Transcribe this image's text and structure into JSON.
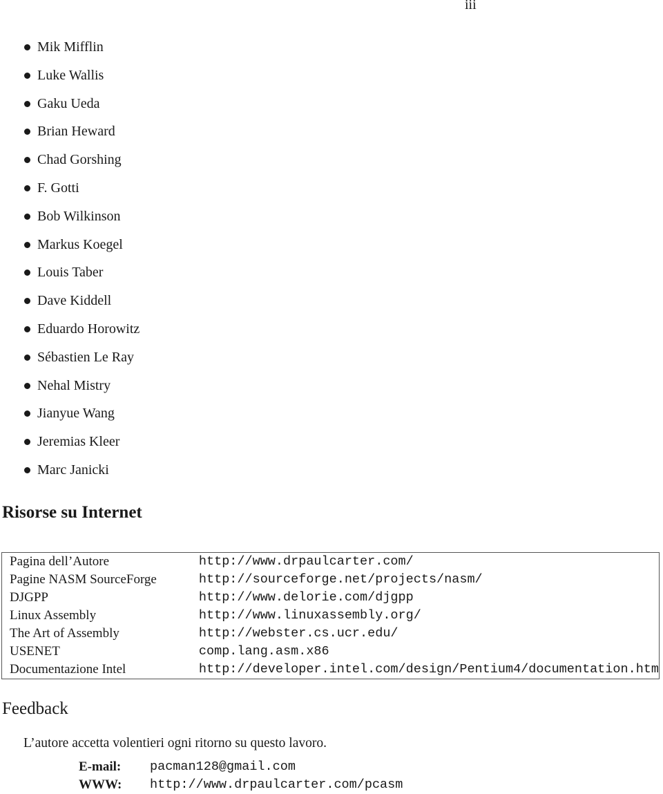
{
  "page": {
    "number": "iii"
  },
  "acknowledgments": [
    "Mik Mifflin",
    "Luke Wallis",
    "Gaku Ueda",
    "Brian Heward",
    "Chad Gorshing",
    "F. Gotti",
    "Bob Wilkinson",
    "Markus Koegel",
    "Louis Taber",
    "Dave Kiddell",
    "Eduardo Horowitz",
    "Sébastien Le Ray",
    "Nehal Mistry",
    "Jianyue Wang",
    "Jeremias Kleer",
    "Marc Janicki"
  ],
  "resources": {
    "title": "Risorse su Internet",
    "rows": [
      {
        "label": "Pagina dell’Autore",
        "url": "http://www.drpaulcarter.com/"
      },
      {
        "label": "Pagine NASM SourceForge",
        "url": "http://sourceforge.net/projects/nasm/"
      },
      {
        "label": "DJGPP",
        "url": "http://www.delorie.com/djgpp"
      },
      {
        "label": "Linux Assembly",
        "url": "http://www.linuxassembly.org/"
      },
      {
        "label": "The Art of Assembly",
        "url": "http://webster.cs.ucr.edu/"
      },
      {
        "label": "USENET",
        "url": "comp.lang.asm.x86"
      },
      {
        "label": "Documentazione Intel",
        "url": "http://developer.intel.com/design/Pentium4/documentation.htm"
      }
    ]
  },
  "feedback": {
    "title": "Feedback",
    "text": "L’autore accetta volentieri ogni ritorno su questo lavoro.",
    "contacts": [
      {
        "label": "E-mail:",
        "value": "pacman128@gmail.com"
      },
      {
        "label": "WWW:",
        "value": "http://www.drpaulcarter.com/pcasm"
      }
    ]
  }
}
